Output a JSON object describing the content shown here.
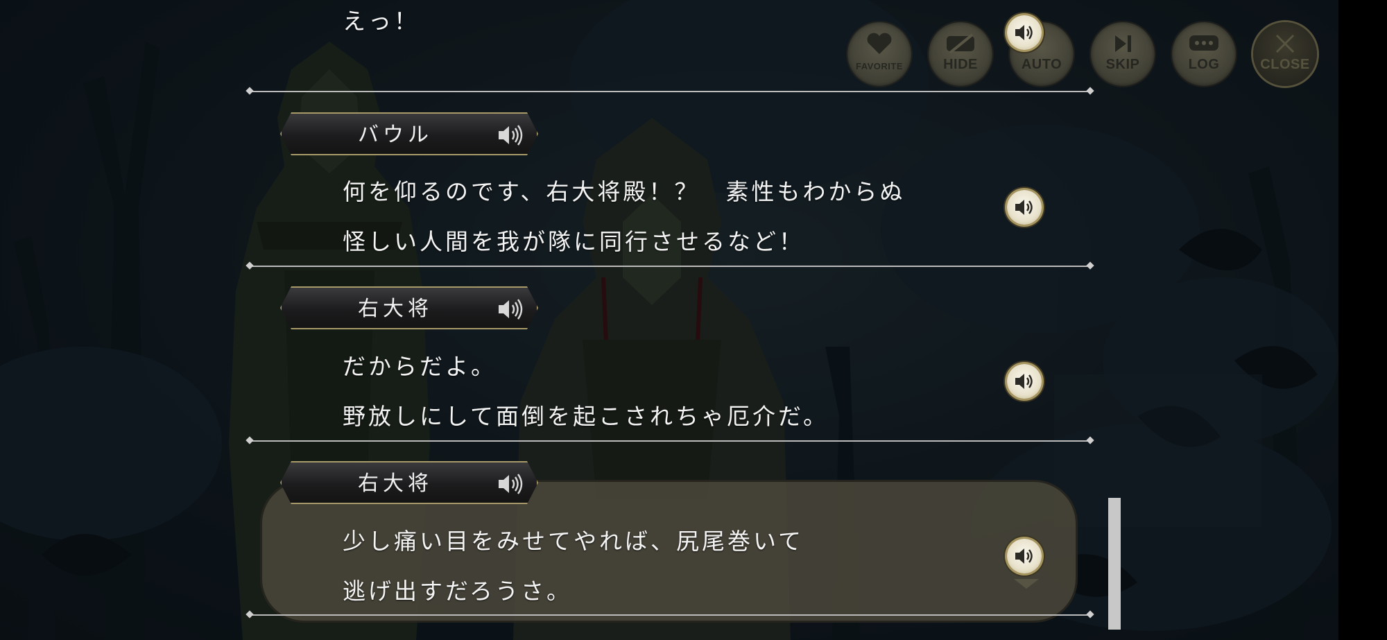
{
  "toolbar": {
    "favorite": "FAVORITE",
    "hide": "HIDE",
    "auto": "AUTO",
    "skip": "SKIP",
    "log": "LOG",
    "close": "CLOSE"
  },
  "log": {
    "entries": [
      {
        "speaker": "",
        "lines": [
          "えっ！"
        ]
      },
      {
        "speaker": "バウル",
        "lines": [
          "何を仰るのです、右大将殿！？　素性もわからぬ",
          "怪しい人間を我が隊に同行させるなど！"
        ]
      },
      {
        "speaker": "右大将",
        "lines": [
          "だからだよ。",
          "野放しにして面倒を起こされちゃ厄介だ。"
        ]
      },
      {
        "speaker": "右大将",
        "lines": [
          "少し痛い目をみせてやれば、尻尾巻いて",
          "逃げ出すだろうさ。"
        ]
      }
    ]
  },
  "colors": {
    "accent_gold": "#a99a6a",
    "text": "#f4f4f4",
    "divider": "#bcbcbc"
  },
  "icons": {
    "voice": "speaker-icon",
    "favorite": "heart-icon",
    "hide": "hide-icon",
    "auto": "auto-icon",
    "skip": "skip-icon",
    "log": "chat-bubble-icon",
    "close": "close-icon"
  }
}
